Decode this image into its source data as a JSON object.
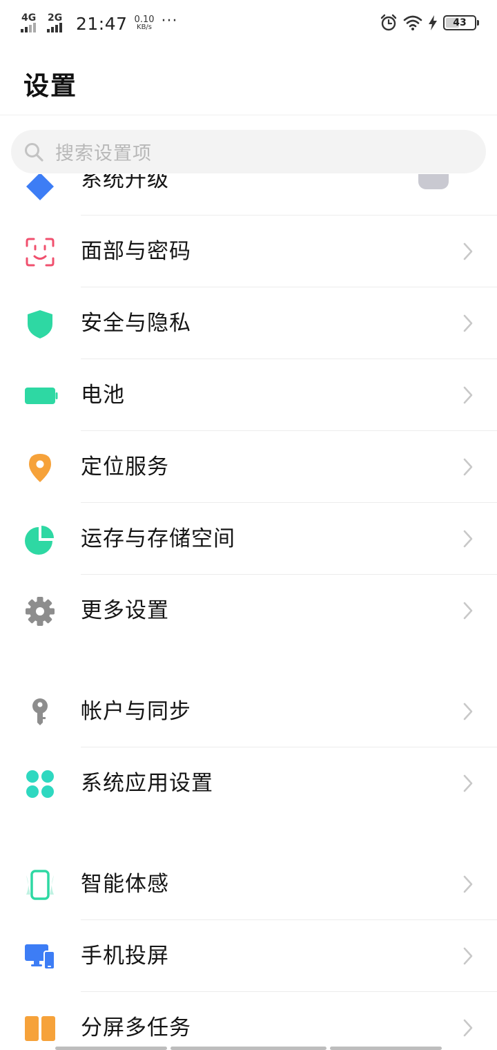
{
  "status_bar": {
    "signal1": "4G",
    "signal2": "2G",
    "time": "21:47",
    "speed_value": "0.10",
    "speed_unit": "KB/s",
    "more": "···",
    "battery_level": "43",
    "icons": [
      "alarm-icon",
      "wifi-icon",
      "charging-icon",
      "battery-icon"
    ]
  },
  "header": {
    "title": "设置"
  },
  "search": {
    "placeholder": "搜索设置项"
  },
  "list": {
    "partial_item": {
      "label": "系统升级",
      "icon": "system-update-icon"
    },
    "items": [
      {
        "label": "面部与密码",
        "icon": "face-id-icon",
        "color": "#f0506e"
      },
      {
        "label": "安全与隐私",
        "icon": "shield-icon",
        "color": "#2ed8a3"
      },
      {
        "label": "电池",
        "icon": "battery-icon",
        "color": "#2ed8a3"
      },
      {
        "label": "定位服务",
        "icon": "location-pin-icon",
        "color": "#f6a23a"
      },
      {
        "label": "运存与存储空间",
        "icon": "pie-chart-icon",
        "color": "#2ed8a3"
      },
      {
        "label": "更多设置",
        "icon": "gear-icon",
        "color": "#8d8d8d"
      },
      {
        "label": "帐户与同步",
        "icon": "key-icon",
        "color": "#8d8d8d"
      },
      {
        "label": "系统应用设置",
        "icon": "apps-grid-icon",
        "color": "#2ed8c0"
      },
      {
        "label": "智能体感",
        "icon": "phone-motion-icon",
        "color": "#2ed8a3"
      },
      {
        "label": "手机投屏",
        "icon": "screen-cast-icon",
        "color": "#3d7df5"
      },
      {
        "label": "分屏多任务",
        "icon": "split-screen-icon",
        "color": "#f6a23a"
      }
    ]
  }
}
